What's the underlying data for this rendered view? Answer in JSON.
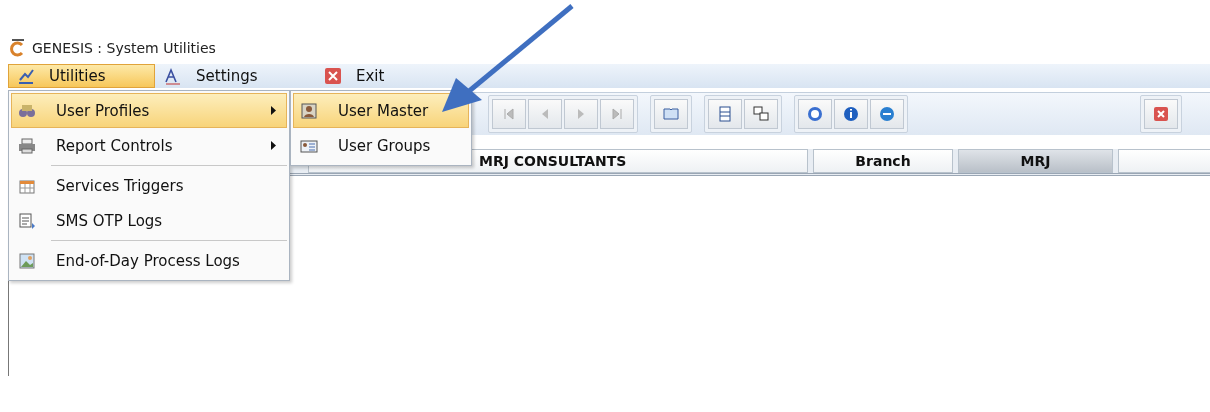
{
  "window": {
    "title": "GENESIS : System Utilities"
  },
  "menubar": [
    {
      "label": "Utilities",
      "selected": true,
      "kind": "utilities"
    },
    {
      "label": "Settings",
      "selected": false,
      "kind": "settings"
    },
    {
      "label": "Exit",
      "selected": false,
      "kind": "exit"
    }
  ],
  "menu": [
    {
      "kind": "item",
      "label": "User Profiles",
      "has_submenu": true,
      "selected": true
    },
    {
      "kind": "item",
      "label": "Report Controls",
      "has_submenu": true,
      "selected": false
    },
    {
      "kind": "separator"
    },
    {
      "kind": "item",
      "label": "Services Triggers",
      "has_submenu": false,
      "selected": false
    },
    {
      "kind": "item",
      "label": "SMS OTP Logs",
      "has_submenu": false,
      "selected": false
    },
    {
      "kind": "separator"
    },
    {
      "kind": "item",
      "label": "End-of-Day Process Logs",
      "has_submenu": false,
      "selected": false
    }
  ],
  "submenu": [
    {
      "label": "User Master",
      "selected": true
    },
    {
      "label": "User Groups",
      "selected": false
    }
  ],
  "info_bar": {
    "company": "MRJ CONSULTANTS",
    "branch_label": "Branch",
    "branch_value": "MRJ"
  }
}
